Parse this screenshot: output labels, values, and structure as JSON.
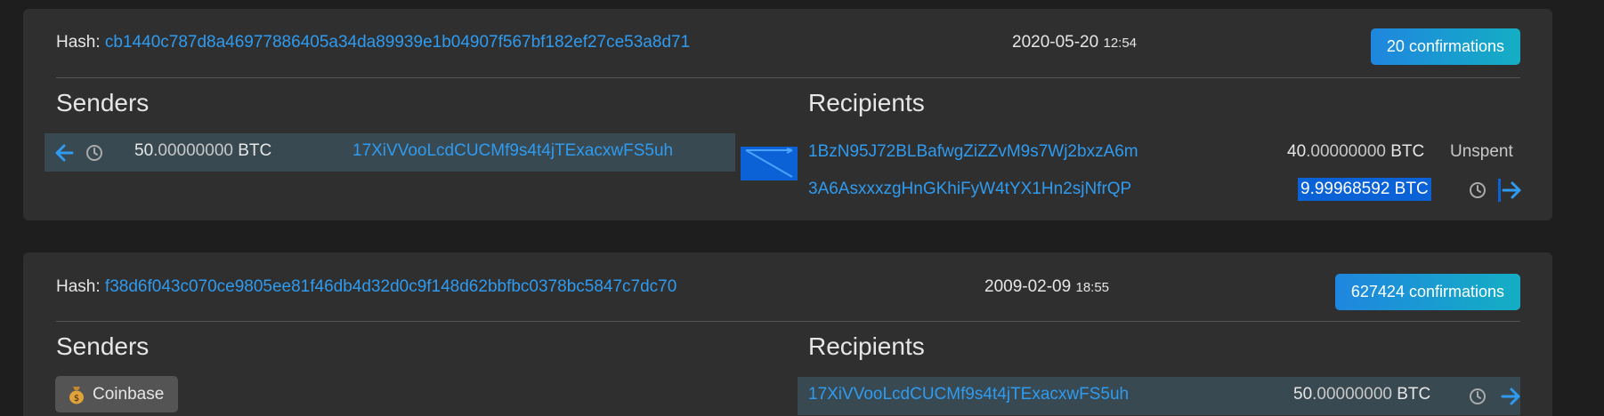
{
  "transactions": [
    {
      "hash_label": "Hash:",
      "hash": "cb1440c787d8a46977886405a34da89939e1b04907f567bf182ef27ce53a8d71",
      "date": "2020-05-20",
      "time": "12:54",
      "confirmations": "20 confirmations",
      "senders_title": "Senders",
      "recipients_title": "Recipients",
      "sender": {
        "amount_int": "50",
        "amount_dec": ".00000000",
        "unit": "BTC",
        "address": "17XiVVooLcdCUCMf9s4t4jTExacxwFS5uh"
      },
      "recipients": [
        {
          "address": "1BzN95J72BLBafwgZiZZvM9s7Wj2bxzA6m",
          "amount_int": "40",
          "amount_dec": ".00000000",
          "unit": "BTC",
          "status": "Unspent"
        },
        {
          "address": "3A6AsxxxzgHnGKhiFyW4tYX1Hn2sjNfrQP",
          "amount_full": "9.99968592 BTC"
        }
      ]
    },
    {
      "hash_label": "Hash:",
      "hash": "f38d6f043c070ce9805ee81f46db4d32d0c9f148d62bbfbc0378bc5847c7dc70",
      "date": "2009-02-09",
      "time": "18:55",
      "confirmations": "627424 confirmations",
      "senders_title": "Senders",
      "recipients_title": "Recipients",
      "coinbase_label": "Coinbase",
      "recipients": [
        {
          "address": "17XiVVooLcdCUCMf9s4t4jTExacxwFS5uh",
          "amount_int": "50",
          "amount_dec": ".00000000",
          "unit": "BTC"
        }
      ]
    }
  ],
  "colors": {
    "link": "#2f9bf0",
    "accent_from": "#1f86df",
    "accent_to": "#14aec4",
    "selection": "#0a62d6"
  },
  "icons": {
    "back": "arrow-left-icon",
    "clock": "clock-icon",
    "forward": "arrow-right-icon",
    "coinbase": "money-bag-icon"
  }
}
